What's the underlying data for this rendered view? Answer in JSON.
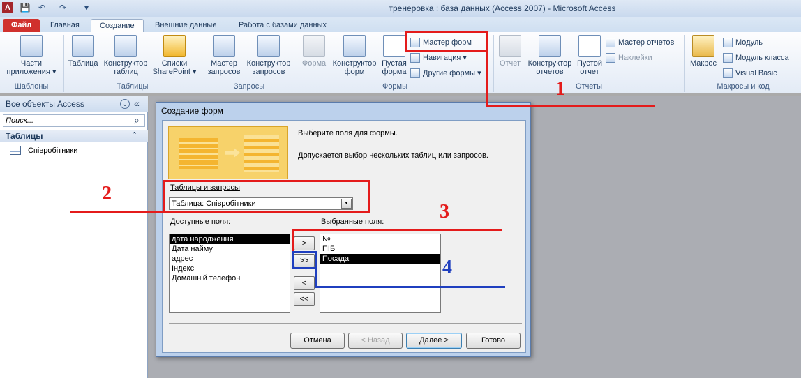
{
  "window": {
    "title": "тренеровка : база данных (Access 2007)  -  Microsoft Access",
    "app_icon": "A"
  },
  "qat": {
    "save": "💾",
    "undo": "↶",
    "redo": "↷",
    "customize": "▾"
  },
  "tabs": [
    "Файл",
    "Главная",
    "Создание",
    "Внешние данные",
    "Работа с базами данных"
  ],
  "ribbon": {
    "groups": {
      "templates": "Шаблоны",
      "tables": "Таблицы",
      "queries": "Запросы",
      "forms": "Формы",
      "reports": "Отчеты",
      "macros": "Макросы и код"
    },
    "buttons": {
      "app_parts": [
        "Части",
        "приложения ▾"
      ],
      "table": [
        "Таблица"
      ],
      "table_designer": [
        "Конструктор",
        "таблиц"
      ],
      "sharepoint": [
        "Списки",
        "SharePoint ▾"
      ],
      "query_wizard": [
        "Мастер",
        "запросов"
      ],
      "query_designer": [
        "Конструктор",
        "запросов"
      ],
      "form": [
        "Форма"
      ],
      "form_designer": [
        "Конструктор",
        "форм"
      ],
      "blank_form": [
        "Пустая",
        "форма"
      ],
      "report": [
        "Отчет"
      ],
      "report_designer": [
        "Конструктор",
        "отчетов"
      ],
      "blank_report": [
        "Пустой",
        "отчет"
      ],
      "macro": [
        "Макрос"
      ]
    },
    "small": {
      "form_wizard": "Мастер форм",
      "navigation": "Навигация ▾",
      "other_forms": "Другие формы ▾",
      "report_wizard": "Мастер отчетов",
      "labels": "Наклейки",
      "module": "Модуль",
      "class_module": "Модуль класса",
      "visual_basic": "Visual Basic"
    }
  },
  "nav": {
    "header": "Все объекты Access",
    "collapse": "«",
    "menu": "⌄",
    "search_placeholder": "Поиск...",
    "search_icon": "⌕",
    "section": "Таблицы",
    "section_toggle": "⌃",
    "items": [
      "Співробітники"
    ]
  },
  "dialog": {
    "title": "Создание форм",
    "instruction1": "Выберите поля для формы.",
    "instruction2": "Допускается выбор нескольких таблиц или запросов.",
    "tables_label": "Таблицы и запросы",
    "table_value": "Таблица: Співробітники",
    "dropdown_arrow": "▼",
    "available_label": "Доступные поля:",
    "selected_label": "Выбранные поля:",
    "available_fields": [
      "дата народження",
      "Дата найму",
      "адрес",
      "Індекс",
      "Домашній телефон"
    ],
    "selected_fields": [
      "№",
      "ПІБ",
      "Посада"
    ],
    "move_buttons": {
      "one": ">",
      "all": ">>",
      "back_one": "<",
      "back_all": "<<"
    },
    "buttons": {
      "cancel": "Отмена",
      "back": "< Назад",
      "next": "Далее >",
      "finish": "Готово"
    }
  },
  "annotations": {
    "n1": "1",
    "n2": "2",
    "n3": "3",
    "n4": "4"
  },
  "colors": {
    "annotation_red": "#e41b1b",
    "annotation_blue": "#1f3fbf",
    "file_tab": "#d0312d"
  }
}
